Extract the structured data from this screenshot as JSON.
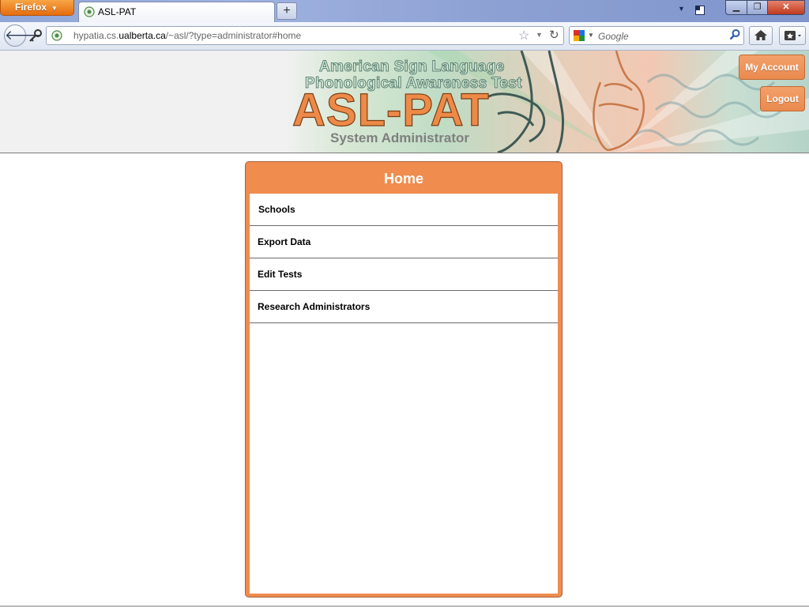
{
  "browser": {
    "app_button_label": "Firefox",
    "tab_title": "ASL-PAT",
    "new_tab_label": "+",
    "url_host_prefix": "hypatia.cs.",
    "url_host_domain": "ualberta.ca",
    "url_path": "/~asl/?type=administrator#home",
    "search_placeholder": "Google",
    "icons": [
      "firefox-caret-icon",
      "tab-favicon-icon",
      "back-arrow-icon",
      "key-icon",
      "site-identity-icon",
      "bookmark-star-icon",
      "history-dropdown-icon",
      "reload-icon",
      "google-icon",
      "search-icon",
      "home-icon",
      "bookmarks-icon",
      "minimize-icon",
      "maximize-icon",
      "close-icon"
    ]
  },
  "banner": {
    "line1": "American Sign Language",
    "line2": "Phonological Awareness Test",
    "title": "ASL-PAT",
    "role": "System Administrator",
    "my_account_label": "My Account",
    "logout_label": "Logout",
    "accent_color": "#f08c4e"
  },
  "panel": {
    "title": "Home",
    "items": [
      {
        "label": "Schools"
      },
      {
        "label": "Export Data"
      },
      {
        "label": "Edit Tests"
      },
      {
        "label": "Research Administrators"
      }
    ]
  }
}
